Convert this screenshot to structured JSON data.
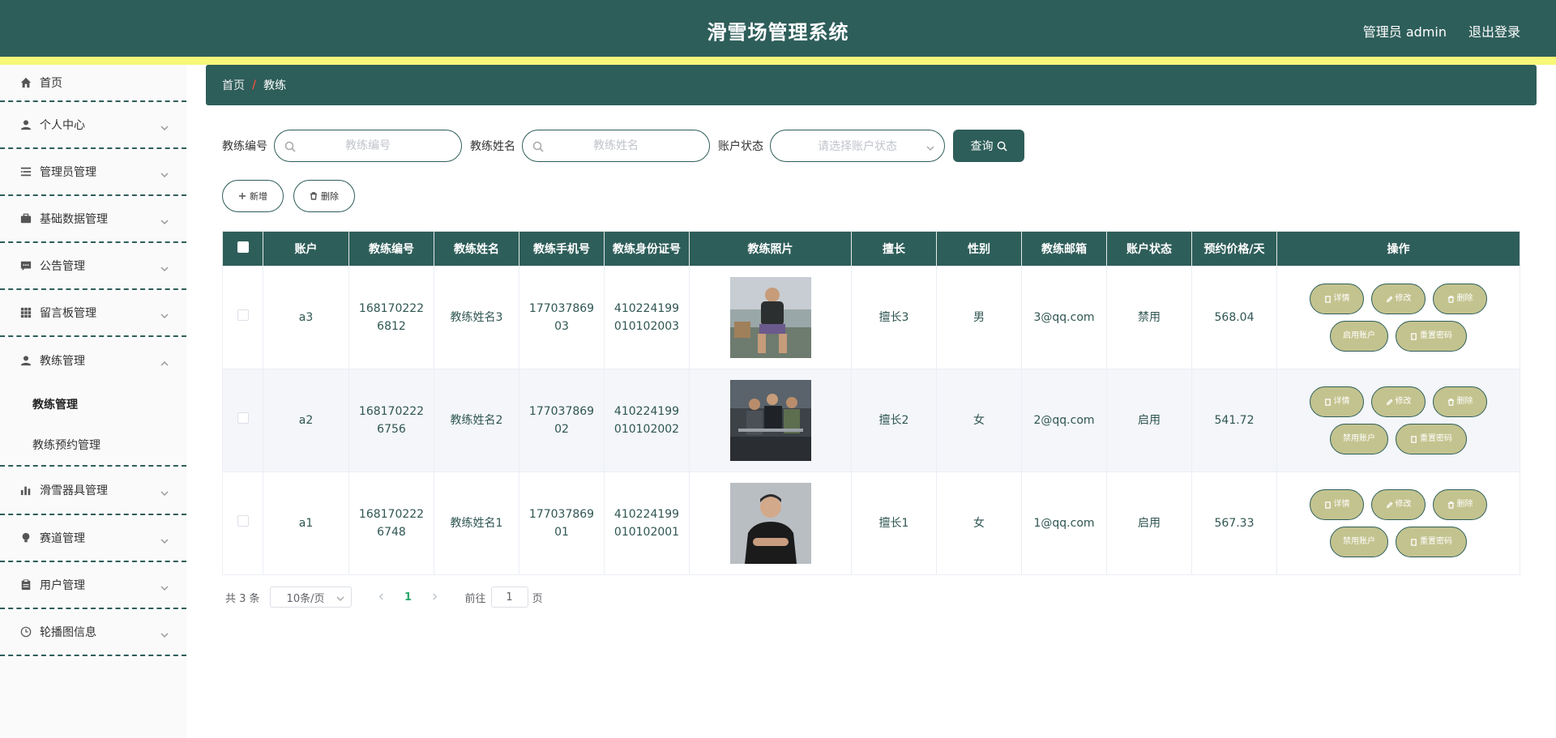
{
  "header": {
    "title": "滑雪场管理系统",
    "user": "管理员 admin",
    "logout": "退出登录"
  },
  "sidebar": {
    "items": [
      {
        "label": "首页",
        "icon": "home-icon"
      },
      {
        "label": "个人中心",
        "icon": "user-icon"
      },
      {
        "label": "管理员管理",
        "icon": "list-icon"
      },
      {
        "label": "基础数据管理",
        "icon": "briefcase-icon"
      },
      {
        "label": "公告管理",
        "icon": "message-icon"
      },
      {
        "label": "留言板管理",
        "icon": "grid-icon"
      },
      {
        "label": "教练管理",
        "icon": "user-icon"
      },
      {
        "label": "滑雪器具管理",
        "icon": "bar-chart-icon"
      },
      {
        "label": "赛道管理",
        "icon": "bulb-icon"
      },
      {
        "label": "用户管理",
        "icon": "clipboard-icon"
      },
      {
        "label": "轮播图信息",
        "icon": "clock-icon"
      }
    ],
    "coach_sub": [
      "教练管理",
      "教练预约管理"
    ]
  },
  "breadcrumb": {
    "home": "首页",
    "sep": "/",
    "current": "教练"
  },
  "search": {
    "no_label": "教练编号",
    "no_placeholder": "教练编号",
    "name_label": "教练姓名",
    "name_placeholder": "教练姓名",
    "status_label": "账户状态",
    "status_placeholder": "请选择账户状态",
    "query": "查询"
  },
  "actions": {
    "add": "新增",
    "delete": "删除"
  },
  "table": {
    "headers": [
      "账户",
      "教练编号",
      "教练姓名",
      "教练手机号",
      "教练身份证号",
      "教练照片",
      "擅长",
      "性别",
      "教练邮箱",
      "账户状态",
      "预约价格/天",
      "操作"
    ],
    "rows": [
      {
        "account": "a3",
        "no": "1681702226812",
        "name": "教练姓名3",
        "phone": "17703786903",
        "idcard": "410224199010102003",
        "skill": "擅长3",
        "gender": "男",
        "email": "3@qq.com",
        "status": "禁用",
        "price": "568.04",
        "toggle": "启用账户"
      },
      {
        "account": "a2",
        "no": "1681702226756",
        "name": "教练姓名2",
        "phone": "17703786902",
        "idcard": "410224199010102002",
        "skill": "擅长2",
        "gender": "女",
        "email": "2@qq.com",
        "status": "启用",
        "price": "541.72",
        "toggle": "禁用账户"
      },
      {
        "account": "a1",
        "no": "1681702226748",
        "name": "教练姓名1",
        "phone": "17703786901",
        "idcard": "410224199010102001",
        "skill": "擅长1",
        "gender": "女",
        "email": "1@qq.com",
        "status": "启用",
        "price": "567.33",
        "toggle": "禁用账户"
      }
    ],
    "ops": {
      "detail": "详情",
      "edit": "修改",
      "delete": "删除",
      "reset": "重置密码"
    }
  },
  "pager": {
    "total": "共 3 条",
    "size": "10条/页",
    "page": "1",
    "goto": "前往",
    "goto_value": "1",
    "unit": "页"
  },
  "colors": {
    "primary": "#2e5e5a",
    "accent_bar": "#f7f779",
    "op_button": "#c3c38f",
    "active_page": "#2ea86d"
  }
}
